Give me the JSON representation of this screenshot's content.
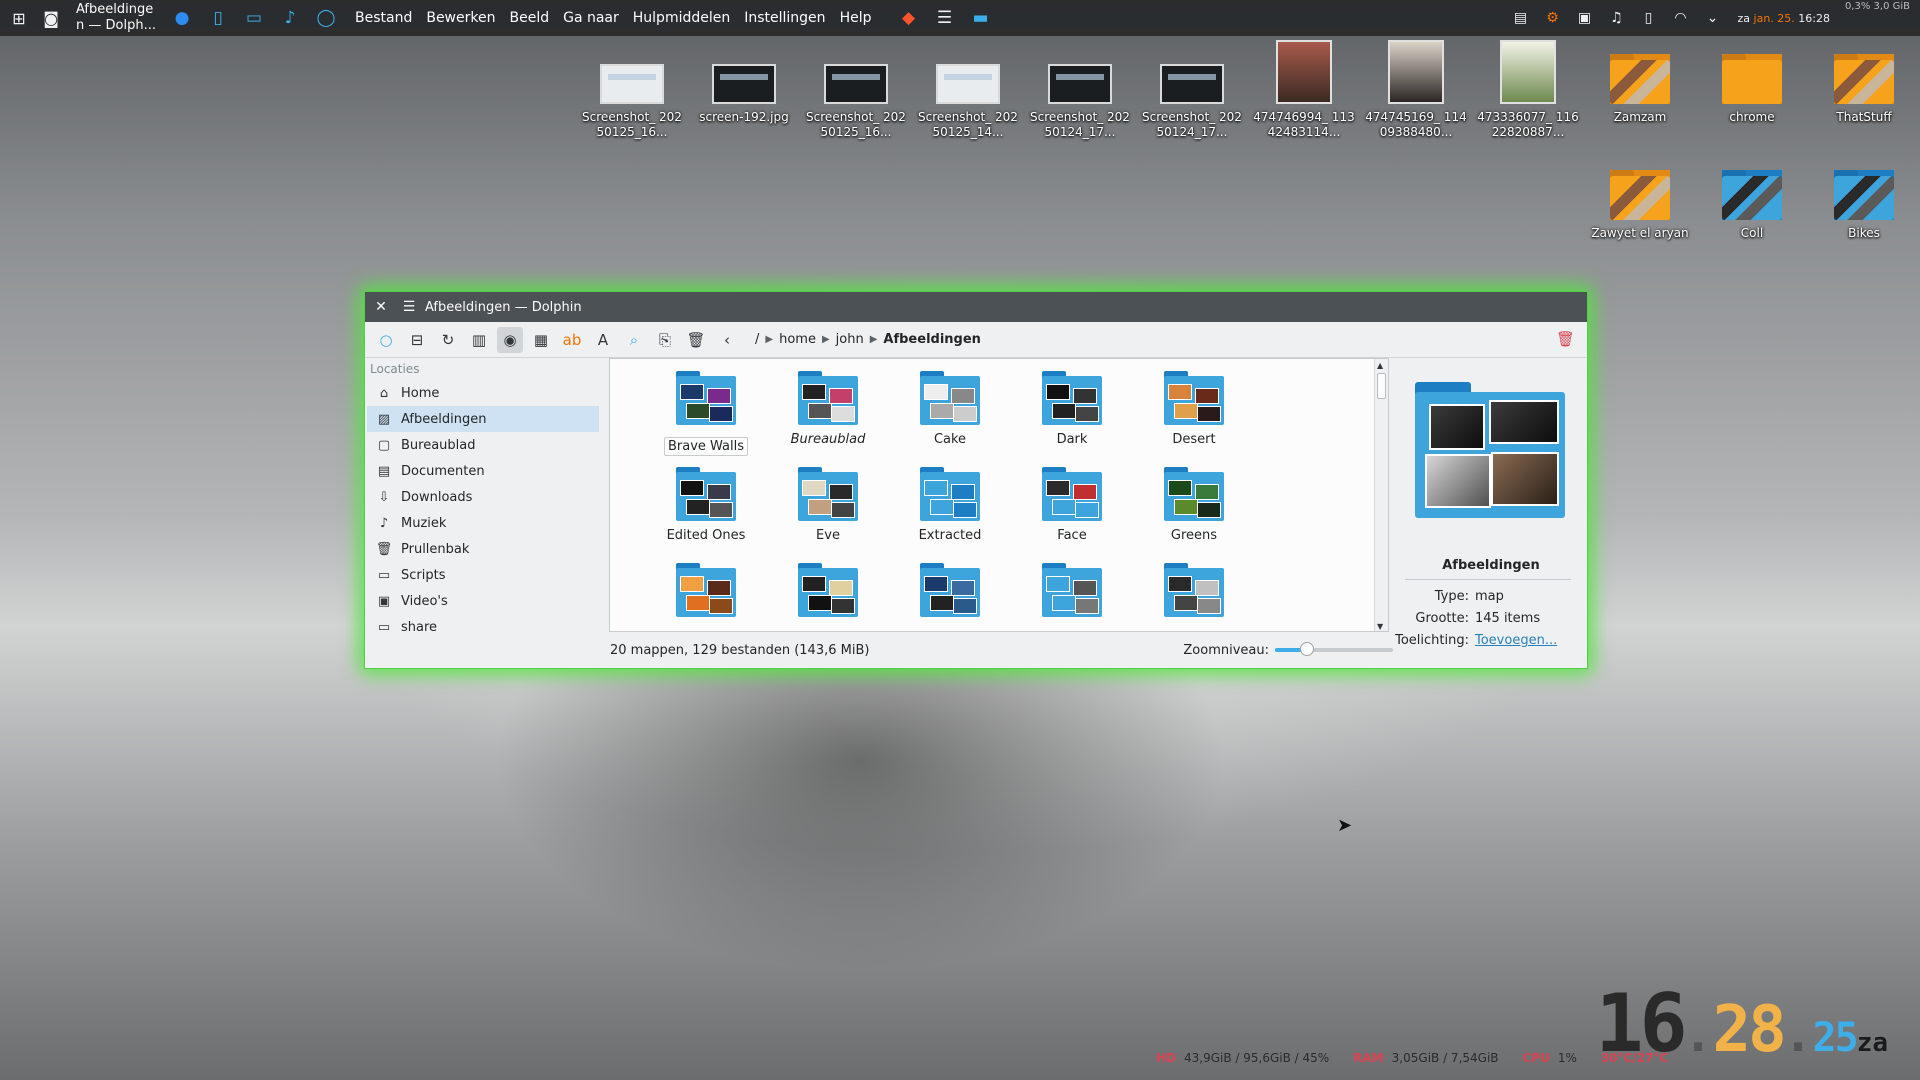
{
  "panel": {
    "task_title": "Afbeeldinge n — Dolph...",
    "menu": [
      "Bestand",
      "Bewerken",
      "Beeld",
      "Ga naar",
      "Hulpmiddelen",
      "Instellingen",
      "Help"
    ],
    "clock_prefix": "za",
    "clock_date": "jan. 25.",
    "clock_time": "16:28",
    "sysload": "0,3% 3,0 GiB"
  },
  "desktop": {
    "icons": [
      {
        "label": "Screenshot_ 20250125_16...",
        "kind": "screenshot-light"
      },
      {
        "label": "screen-192.jpg",
        "kind": "screenshot-dark"
      },
      {
        "label": "Screenshot_ 20250125_16...",
        "kind": "screenshot-dark"
      },
      {
        "label": "Screenshot_ 20250125_14...",
        "kind": "screenshot-light"
      },
      {
        "label": "Screenshot_ 20250124_17...",
        "kind": "screenshot-dark"
      },
      {
        "label": "Screenshot_ 20250124_17...",
        "kind": "screenshot-dark"
      },
      {
        "label": "474746994_ 11342483114...",
        "kind": "photo"
      },
      {
        "label": "474745169_ 11409388480...",
        "kind": "photo-dark"
      },
      {
        "label": "473336077_ 11622820887...",
        "kind": "photo-green"
      },
      {
        "label": "Zamzam",
        "kind": "folder-orange"
      },
      {
        "label": "chrome",
        "kind": "folder-orange-plain"
      },
      {
        "label": "ThatStuff",
        "kind": "folder-orange"
      },
      {
        "label": "Zawyet el aryan",
        "kind": "folder-orange"
      },
      {
        "label": "Coll",
        "kind": "folder-blue"
      },
      {
        "label": "Bikes",
        "kind": "folder-blue"
      }
    ]
  },
  "window": {
    "title": "Afbeeldingen — Dolphin",
    "breadcrumb": {
      "root": "/",
      "parts": [
        "home",
        "john"
      ],
      "current": "Afbeeldingen"
    },
    "sidebar": {
      "header": "Locaties",
      "items": [
        {
          "label": "Home",
          "icon": "home-icon"
        },
        {
          "label": "Afbeeldingen",
          "icon": "pictures-icon"
        },
        {
          "label": "Bureaublad",
          "icon": "desktop-icon"
        },
        {
          "label": "Documenten",
          "icon": "documents-icon"
        },
        {
          "label": "Downloads",
          "icon": "downloads-icon"
        },
        {
          "label": "Muziek",
          "icon": "music-icon"
        },
        {
          "label": "Prullenbak",
          "icon": "trash-icon"
        },
        {
          "label": "Scripts",
          "icon": "folder-icon"
        },
        {
          "label": "Video's",
          "icon": "video-icon"
        },
        {
          "label": "share",
          "icon": "folder-icon"
        }
      ],
      "selected": "Afbeeldingen"
    },
    "files": [
      {
        "label": "Brave Walls",
        "style": "boxed"
      },
      {
        "label": "Bureaublad",
        "style": "italic"
      },
      {
        "label": "Cake",
        "style": ""
      },
      {
        "label": "Dark",
        "style": ""
      },
      {
        "label": "Desert",
        "style": ""
      },
      {
        "label": "Edited Ones",
        "style": ""
      },
      {
        "label": "Eve",
        "style": ""
      },
      {
        "label": "Extracted",
        "style": ""
      },
      {
        "label": "Face",
        "style": ""
      },
      {
        "label": "Greens",
        "style": ""
      },
      {
        "label": "",
        "style": ""
      },
      {
        "label": "",
        "style": ""
      },
      {
        "label": "",
        "style": ""
      },
      {
        "label": "",
        "style": ""
      },
      {
        "label": "",
        "style": ""
      }
    ],
    "info": {
      "title": "Afbeeldingen",
      "type_label": "Type:",
      "type_value": "map",
      "size_label": "Grootte:",
      "size_value": "145 items",
      "comment_label": "Toelichting:",
      "comment_value": "Toevoegen..."
    },
    "status": "20 mappen, 129 bestanden (143,6 MiB)",
    "zoom_label": "Zoomniveau:",
    "zoom_level": 0.27
  },
  "overlay": {
    "clock_h": "16",
    "clock_m": "28",
    "clock_s": "25",
    "clock_d": "za",
    "hd_label": "HD",
    "hd_value": "43,9GiB / 95,6GiB / 45%",
    "ram_label": "RAM",
    "ram_value": "3,05GiB / 7,54GiB",
    "cpu_label": "CPU",
    "cpu_value": "1%",
    "temp_value": "30°C/27°C"
  },
  "colors": {
    "accent": "#3daee9",
    "window_glow": "#50e63c",
    "folder_blue": "#3da4dc",
    "folder_orange": "#f7a21b",
    "hd_red": "#da4453"
  }
}
